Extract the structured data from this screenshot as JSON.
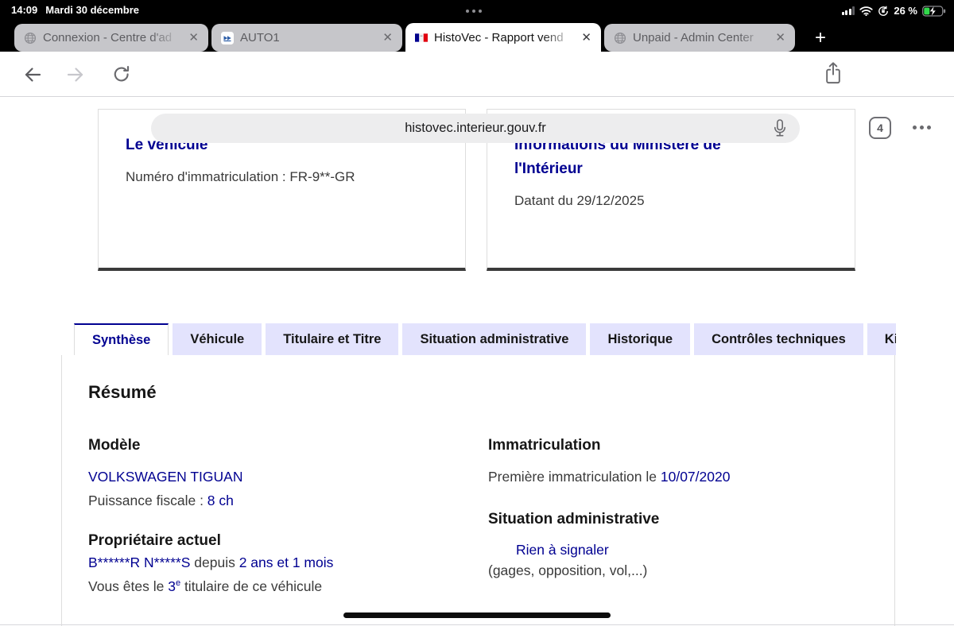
{
  "status_bar": {
    "time": "14:09",
    "date": "Mardi 30 décembre",
    "battery_percent": "26 %"
  },
  "safari": {
    "tabs": [
      {
        "title": "Connexion - Centre d'ad"
      },
      {
        "title": "AUTO1"
      },
      {
        "title": "HistoVec - Rapport vend"
      },
      {
        "title": "Unpaid - Admin Center"
      }
    ],
    "close_glyph": "✕",
    "new_tab_glyph": "+",
    "url": "histovec.interieur.gouv.fr",
    "tab_count": "4"
  },
  "cards": [
    {
      "title": "Le véhicule",
      "body": "Numéro d'immatriculation : FR-9**-GR"
    },
    {
      "title": "Informations du Ministère de l'Intérieur",
      "body": "Datant du 29/12/2025"
    }
  ],
  "report_tabs": [
    {
      "label": "Synthèse"
    },
    {
      "label": "Véhicule"
    },
    {
      "label": "Titulaire et Titre"
    },
    {
      "label": "Situation administrative"
    },
    {
      "label": "Historique"
    },
    {
      "label": "Contrôles techniques"
    },
    {
      "label": "Kilométrage"
    }
  ],
  "synthese": {
    "heading": "Résumé",
    "model": {
      "heading": "Modèle",
      "name": "VOLKSWAGEN TIGUAN",
      "power_label": "Puissance fiscale : ",
      "power_value": "8 ch"
    },
    "owner": {
      "heading": "Propriétaire actuel",
      "name": "B******R N*****S",
      "since_label": " depuis ",
      "since_value": "2 ans et 1 mois",
      "rank_prefix": "Vous êtes le ",
      "rank_value": "3",
      "rank_sup": "e",
      "rank_suffix": " titulaire de ce véhicule"
    },
    "registration": {
      "heading": "Immatriculation",
      "first_label": "Première immatriculation le ",
      "first_date": "10/07/2020"
    },
    "admin": {
      "heading": "Situation administrative",
      "status": "Rien à signaler",
      "note": "(gages, opposition, vol,...)"
    }
  },
  "colors": {
    "accent_blue": "#000091",
    "report_tab_bg": "#e3e3fd",
    "battery_green": "#32d74b"
  }
}
